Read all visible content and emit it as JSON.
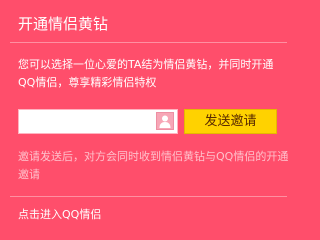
{
  "panel": {
    "title": "开通情侣黄钻",
    "description": "您可以选择一位心爱的TA结为情侣黄钻，并同时开通QQ情侣，尊享精彩情侣特权",
    "invite": {
      "input_value": "",
      "input_placeholder": "",
      "contact_icon": "contact-person-icon",
      "send_label": "发送邀请"
    },
    "hint": "邀请发送后，对方会同时收到情侣黄钻与QQ情侣的开通邀请",
    "enter_link": "点击进入QQ情侣"
  },
  "colors": {
    "background": "#ff4e6b",
    "button": "#ffd200",
    "hint_text": "#ffc0cb"
  }
}
